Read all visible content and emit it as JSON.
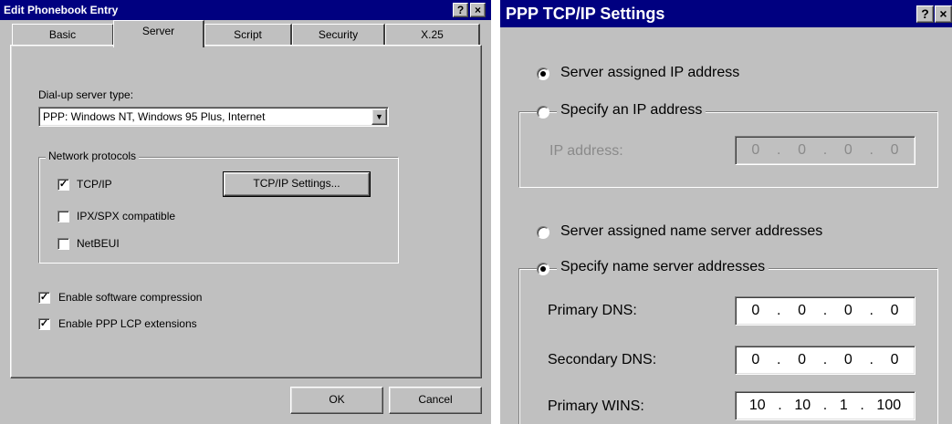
{
  "left_dialog": {
    "title": "Edit Phonebook Entry",
    "tabs": [
      "Basic",
      "Server",
      "Script",
      "Security",
      "X.25"
    ],
    "active_tab": "Server",
    "server_type": {
      "label": "Dial-up server type:",
      "value": "PPP: Windows NT, Windows 95 Plus, Internet"
    },
    "network_protocols": {
      "legend": "Network protocols",
      "items": [
        {
          "label": "TCP/IP",
          "checked": true
        },
        {
          "label": "IPX/SPX compatible",
          "checked": false
        },
        {
          "label": "NetBEUI",
          "checked": false
        }
      ]
    },
    "tcpip_settings_button": "TCP/IP Settings...",
    "options": [
      {
        "label": "Enable software compression",
        "checked": true
      },
      {
        "label": "Enable PPP LCP extensions",
        "checked": true
      }
    ],
    "ok_button": "OK",
    "cancel_button": "Cancel"
  },
  "right_dialog": {
    "title": "PPP TCP/IP Settings",
    "ip": {
      "server_assigned_label": "Server assigned IP address",
      "specify_label": "Specify an IP address",
      "selected": "server_assigned",
      "address_label": "IP address:",
      "address": [
        "0",
        "0",
        "0",
        "0"
      ]
    },
    "dns": {
      "server_assigned_label": "Server assigned name server addresses",
      "specify_label": "Specify name server addresses",
      "selected": "specify",
      "primary_dns_label": "Primary DNS:",
      "primary_dns": [
        "0",
        "0",
        "0",
        "0"
      ],
      "secondary_dns_label": "Secondary DNS:",
      "secondary_dns": [
        "0",
        "0",
        "0",
        "0"
      ],
      "primary_wins_label": "Primary WINS:",
      "primary_wins": [
        "10",
        "10",
        "1",
        "100"
      ]
    }
  },
  "icons": {
    "help": "?",
    "close": "×",
    "check": "✓",
    "dropdown": "▼"
  },
  "colors": {
    "titlebar": "#000080",
    "face": "#c0c0c0"
  }
}
